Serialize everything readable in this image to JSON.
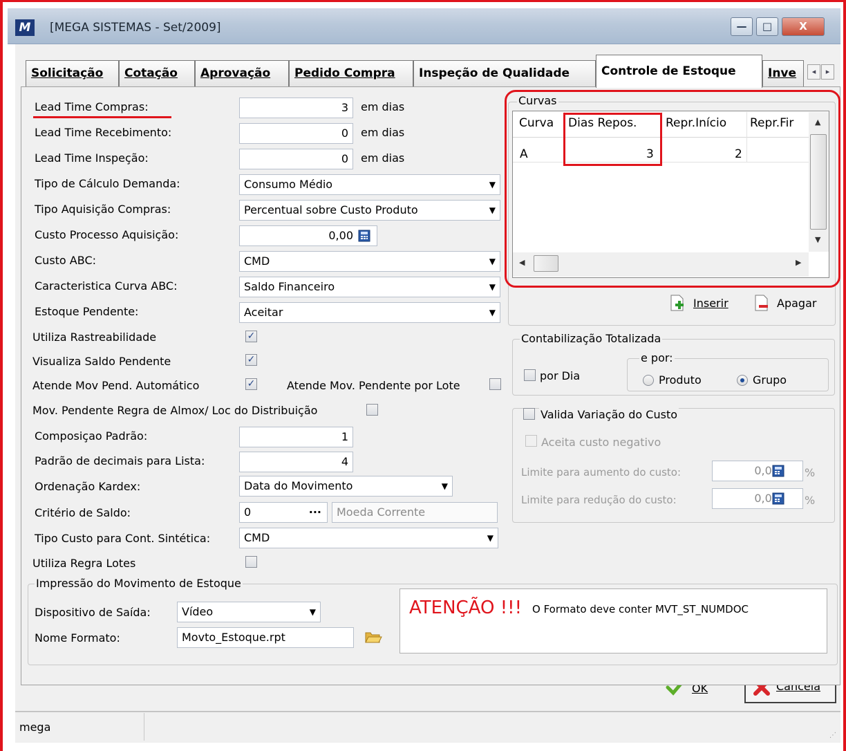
{
  "window": {
    "title": "[MEGA SISTEMAS - Set/2009]",
    "logo_text": "M",
    "min_glyph": "—",
    "max_glyph": "□",
    "close_glyph": "X"
  },
  "tabs": [
    {
      "label": "Solicitação"
    },
    {
      "label": "Cotação"
    },
    {
      "label": "Aprovação"
    },
    {
      "label": "Pedido Compra"
    },
    {
      "label": "Inspeção de Qualidade"
    },
    {
      "label": "Controle de Estoque",
      "active": true
    },
    {
      "label": "Inve"
    }
  ],
  "tab_scroll": {
    "left": "◂",
    "right": "▸"
  },
  "form": {
    "lead_time_compras": {
      "label": "Lead Time Compras:",
      "value": "3",
      "unit": "em dias"
    },
    "lead_time_recebimento": {
      "label": "Lead Time Recebimento:",
      "value": "0",
      "unit": "em dias"
    },
    "lead_time_inspecao": {
      "label": "Lead Time Inspeção:",
      "value": "0",
      "unit": "em dias"
    },
    "tipo_calculo_demanda": {
      "label": "Tipo de Cálculo Demanda:",
      "value": "Consumo Médio"
    },
    "tipo_aquisicao_compras": {
      "label": "Tipo Aquisição Compras:",
      "value": "Percentual sobre Custo Produto"
    },
    "custo_processo_aquisicao": {
      "label": "Custo Processo Aquisição:",
      "value": "0,00"
    },
    "custo_abc": {
      "label": "Custo ABC:",
      "value": "CMD"
    },
    "caracteristica_curva_abc": {
      "label": "Caracteristica Curva ABC:",
      "value": "Saldo Financeiro"
    },
    "estoque_pendente": {
      "label": "Estoque Pendente:",
      "value": "Aceitar"
    },
    "utiliza_rastreabilidade": {
      "label": "Utiliza Rastreabilidade",
      "checked": true
    },
    "visualiza_saldo_pendente": {
      "label": "Visualiza Saldo Pendente",
      "checked": true
    },
    "atende_mov_pend_automatico": {
      "label": "Atende Mov Pend. Automático",
      "checked": true
    },
    "atende_mov_pendente_por_lote": {
      "label": "Atende Mov. Pendente por Lote",
      "checked": false
    },
    "mov_pendente_regra_almox": {
      "label": "Mov. Pendente Regra de Almox/ Loc do Distribuição",
      "checked": false
    },
    "composicao_padrao": {
      "label": "Composiçao Padrão:",
      "value": "1"
    },
    "padrao_decimais_lista": {
      "label": "Padrão de decimais para Lista:",
      "value": "4"
    },
    "ordenacao_kardex": {
      "label": "Ordenação Kardex:",
      "value": "Data do Movimento"
    },
    "criterio_saldo": {
      "label": "Critério de Saldo:",
      "value": "0",
      "ellipsis": "...",
      "description": "Moeda Corrente"
    },
    "tipo_custo_cont_sintetica": {
      "label": "Tipo Custo para Cont. Sintética:",
      "value": "CMD"
    },
    "utiliza_regra_lotes": {
      "label": "Utiliza Regra Lotes",
      "checked": false
    }
  },
  "impressao": {
    "title": "Impressão do Movimento de Estoque",
    "dispositivo_label": "Dispositivo de Saída:",
    "dispositivo_value": "Vídeo",
    "nome_formato_label": "Nome Formato:",
    "nome_formato_value": "Movto_Estoque.rpt"
  },
  "atencao": {
    "title": "ATENÇÃO !!!",
    "message": "O Formato deve conter MVT_ST_NUMDOC"
  },
  "curvas": {
    "title": "Curvas",
    "columns": [
      "Curva",
      "Dias Repos.",
      "Repr.Início",
      "Repr.Fir"
    ],
    "rows": [
      {
        "curva": "A",
        "dias_repos": "3",
        "repr_inicio": "2",
        "repr_fim": ""
      }
    ],
    "inserir_label": "Inserir",
    "apagar_label": "Apagar"
  },
  "contabilizacao": {
    "title": "Contabilização Totalizada",
    "por_dia_label": "por Dia",
    "por_dia_checked": false,
    "e_por_label": "e por:",
    "produto_label": "Produto",
    "grupo_label": "Grupo",
    "selected": "Grupo"
  },
  "variacao_custo": {
    "valida_label": "Valida Variação do Custo",
    "valida_checked": false,
    "aceita_negativo_label": "Aceita custo negativo",
    "limite_aumento_label": "Limite para aumento do custo:",
    "limite_aumento_value": "0,00",
    "limite_reducao_label": "Limite para redução do custo:",
    "limite_reducao_value": "0,00",
    "percent": "%"
  },
  "buttons": {
    "ok_label": "OK",
    "cancela_label": "Cancela"
  },
  "statusbar": {
    "text": "mega"
  },
  "colors": {
    "annotation_red": "#e0141c",
    "atencao_red": "#e0141c",
    "window_frame": "#b9c8da"
  }
}
